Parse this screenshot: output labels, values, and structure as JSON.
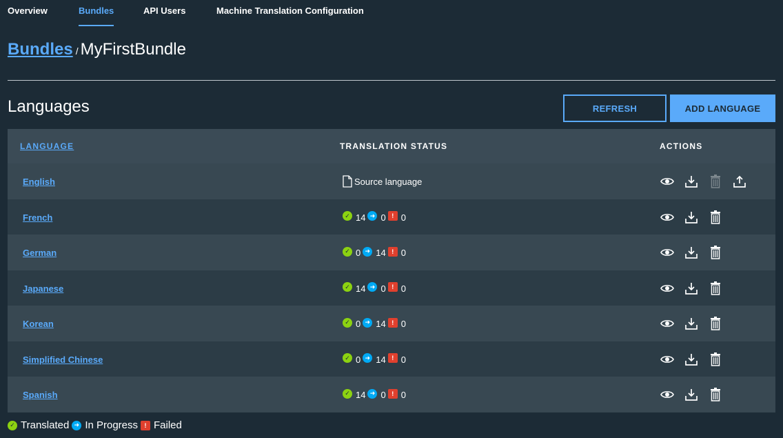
{
  "nav": {
    "tabs": [
      {
        "label": "Overview"
      },
      {
        "label": "Bundles"
      },
      {
        "label": "API Users"
      },
      {
        "label": "Machine Translation Configuration"
      }
    ],
    "active": "Bundles"
  },
  "breadcrumb": {
    "parent": "Bundles",
    "separator": "/",
    "current": "MyFirstBundle"
  },
  "section": {
    "title": "Languages",
    "refresh_label": "REFRESH",
    "add_label": "ADD LANGUAGE"
  },
  "table": {
    "headers": {
      "language": "LANGUAGE",
      "status": "TRANSLATION STATUS",
      "actions": "ACTIONS"
    },
    "rows": [
      {
        "language": "English",
        "source": true,
        "source_label": "Source language"
      },
      {
        "language": "French",
        "translated": "14",
        "in_progress": "0",
        "failed": "0"
      },
      {
        "language": "German",
        "translated": "0",
        "in_progress": "14",
        "failed": "0"
      },
      {
        "language": "Japanese",
        "translated": "14",
        "in_progress": "0",
        "failed": "0"
      },
      {
        "language": "Korean",
        "translated": "0",
        "in_progress": "14",
        "failed": "0"
      },
      {
        "language": "Simplified Chinese",
        "translated": "0",
        "in_progress": "14",
        "failed": "0"
      },
      {
        "language": "Spanish",
        "translated": "14",
        "in_progress": "0",
        "failed": "0"
      }
    ]
  },
  "legend": {
    "translated": "Translated",
    "in_progress": "In Progress",
    "failed": "Failed"
  },
  "icons": {
    "view": "eye-icon",
    "download": "download-icon",
    "delete": "trash-icon",
    "upload": "upload-icon",
    "translated": "check-circle-icon",
    "in_progress": "arrow-circle-icon",
    "failed": "exclamation-square-icon",
    "source": "document-icon"
  },
  "colors": {
    "background": "#1c2b36",
    "accent": "#5aaafa",
    "translated": "#8cd211",
    "in_progress": "#00aaf5",
    "failed": "#e0402e"
  }
}
